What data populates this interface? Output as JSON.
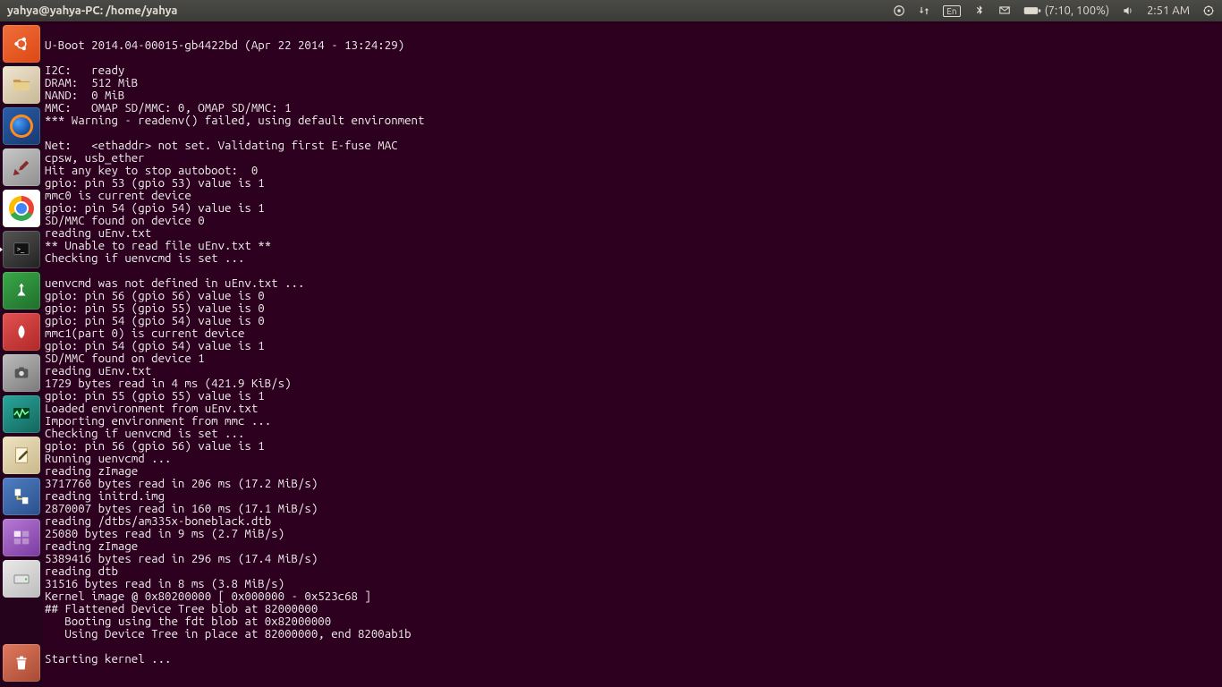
{
  "menubar": {
    "title": "yahya@yahya-PC: /home/yahya",
    "lang": "En",
    "battery": "(7:10, 100%)",
    "clock": "2:51 AM"
  },
  "launcher": {
    "dash": "dash",
    "files": "files",
    "firefox": "firefox",
    "tools": "tools",
    "chrome": "chrome",
    "terminal": "terminal",
    "green": "green-app",
    "pdf": "pdf-reader",
    "screenshot": "screenshot",
    "sysmon": "system-monitor",
    "editor": "text-editor",
    "nettool": "network-tool",
    "purple": "purple-app",
    "drive": "removable-drive",
    "trash": "trash"
  },
  "terminal_lines": [
    "",
    "U-Boot 2014.04-00015-gb4422bd (Apr 22 2014 - 13:24:29)",
    "",
    "I2C:   ready",
    "DRAM:  512 MiB",
    "NAND:  0 MiB",
    "MMC:   OMAP SD/MMC: 0, OMAP SD/MMC: 1",
    "*** Warning - readenv() failed, using default environment",
    "",
    "Net:   <ethaddr> not set. Validating first E-fuse MAC",
    "cpsw, usb_ether",
    "Hit any key to stop autoboot:  0",
    "gpio: pin 53 (gpio 53) value is 1",
    "mmc0 is current device",
    "gpio: pin 54 (gpio 54) value is 1",
    "SD/MMC found on device 0",
    "reading uEnv.txt",
    "** Unable to read file uEnv.txt **",
    "Checking if uenvcmd is set ...",
    "",
    "uenvcmd was not defined in uEnv.txt ...",
    "gpio: pin 56 (gpio 56) value is 0",
    "gpio: pin 55 (gpio 55) value is 0",
    "gpio: pin 54 (gpio 54) value is 0",
    "mmc1(part 0) is current device",
    "gpio: pin 54 (gpio 54) value is 1",
    "SD/MMC found on device 1",
    "reading uEnv.txt",
    "1729 bytes read in 4 ms (421.9 KiB/s)",
    "gpio: pin 55 (gpio 55) value is 1",
    "Loaded environment from uEnv.txt",
    "Importing environment from mmc ...",
    "Checking if uenvcmd is set ...",
    "gpio: pin 56 (gpio 56) value is 1",
    "Running uenvcmd ...",
    "reading zImage",
    "3717760 bytes read in 206 ms (17.2 MiB/s)",
    "reading initrd.img",
    "2870007 bytes read in 160 ms (17.1 MiB/s)",
    "reading /dtbs/am335x-boneblack.dtb",
    "25080 bytes read in 9 ms (2.7 MiB/s)",
    "reading zImage",
    "5389416 bytes read in 296 ms (17.4 MiB/s)",
    "reading dtb",
    "31516 bytes read in 8 ms (3.8 MiB/s)",
    "Kernel image @ 0x80200000 [ 0x000000 - 0x523c68 ]",
    "## Flattened Device Tree blob at 82000000",
    "   Booting using the fdt blob at 0x82000000",
    "   Using Device Tree in place at 82000000, end 8200ab1b",
    "",
    "Starting kernel ..."
  ]
}
